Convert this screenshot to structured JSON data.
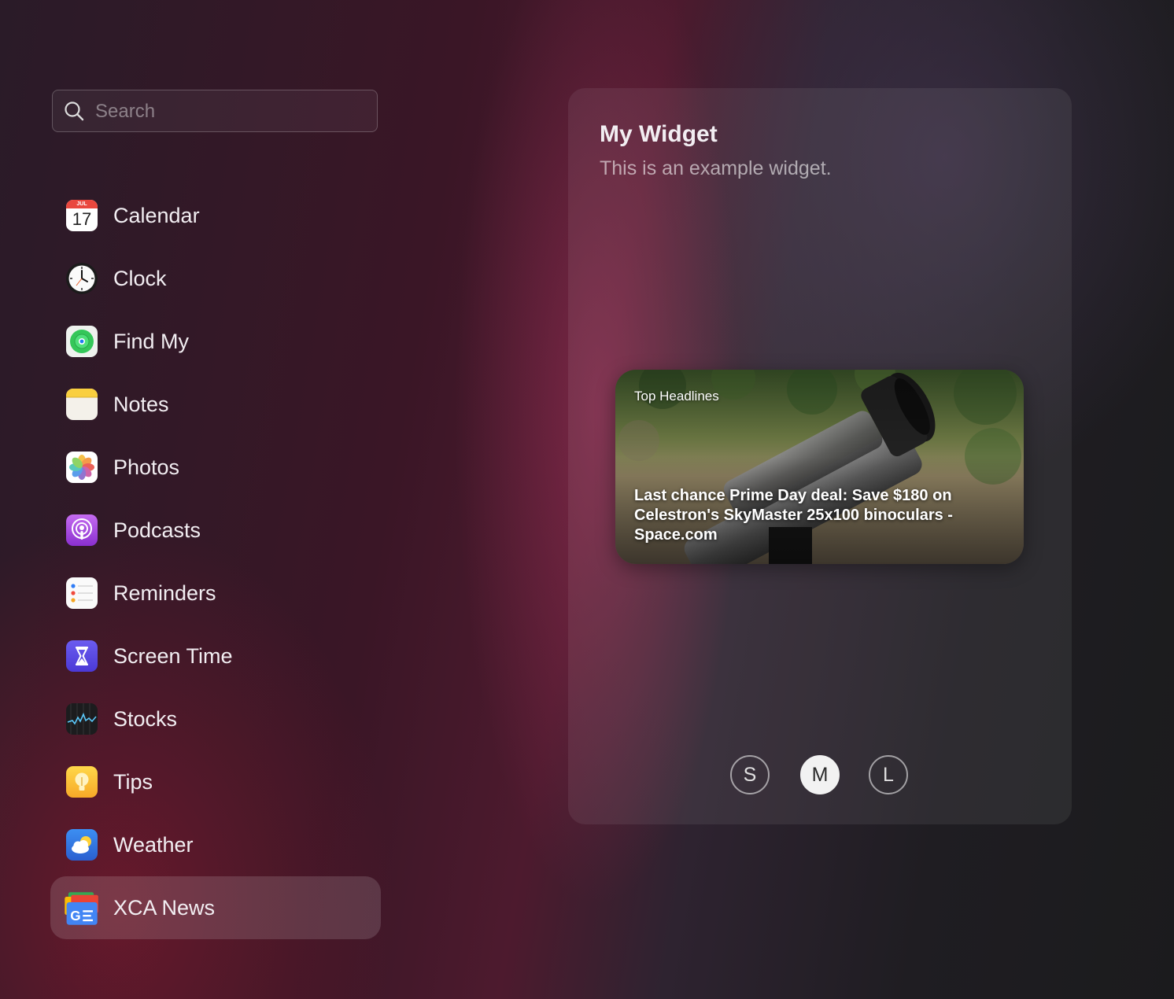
{
  "search": {
    "placeholder": "Search",
    "value": ""
  },
  "sidebar": {
    "items": [
      {
        "label": "Calendar",
        "icon": "calendar-icon",
        "icon_text": "JUL",
        "icon_day": "17"
      },
      {
        "label": "Clock",
        "icon": "clock-icon"
      },
      {
        "label": "Find My",
        "icon": "find-my-icon"
      },
      {
        "label": "Notes",
        "icon": "notes-icon"
      },
      {
        "label": "Photos",
        "icon": "photos-icon"
      },
      {
        "label": "Podcasts",
        "icon": "podcasts-icon"
      },
      {
        "label": "Reminders",
        "icon": "reminders-icon"
      },
      {
        "label": "Screen Time",
        "icon": "screen-time-icon"
      },
      {
        "label": "Stocks",
        "icon": "stocks-icon"
      },
      {
        "label": "Tips",
        "icon": "tips-icon"
      },
      {
        "label": "Weather",
        "icon": "weather-icon"
      },
      {
        "label": "XCA News",
        "icon": "xca-news-icon",
        "selected": true
      }
    ]
  },
  "panel": {
    "title": "My Widget",
    "subtitle": "This is an example widget.",
    "widget": {
      "category": "Top Headlines",
      "headline": "Last chance Prime Day deal: Save $180 on Celestron's SkyMaster 25x100 binoculars - Space.com",
      "image": "binoculars-photo"
    },
    "sizes": [
      {
        "label": "S",
        "selected": false
      },
      {
        "label": "M",
        "selected": true
      },
      {
        "label": "L",
        "selected": false
      }
    ]
  },
  "colors": {
    "selected_row": "#6b3345",
    "active_size": "#f2f2f2"
  }
}
